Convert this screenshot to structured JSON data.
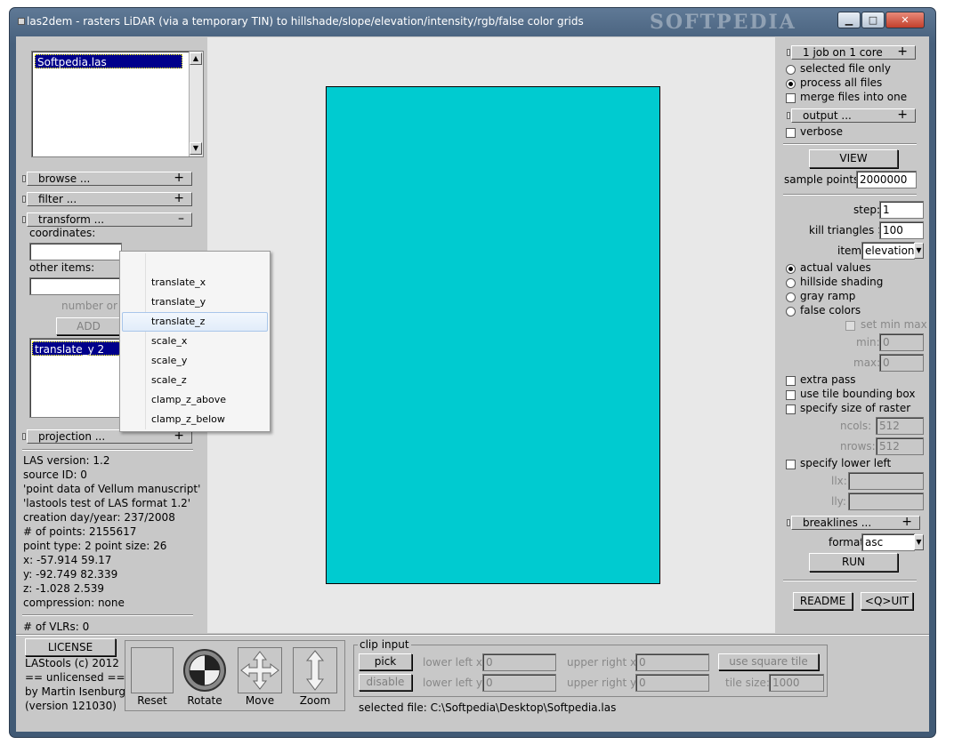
{
  "window": {
    "title": "las2dem - rasters LiDAR (via a temporary TIN) to hillshade/slope/elevation/intensity/rgb/false color grids",
    "watermark": "SOFTPEDIA",
    "minimize_glyph": "▁",
    "maximize_glyph": "□",
    "close_glyph": "✕"
  },
  "left_panel": {
    "file_list": [
      "Softpedia.las"
    ],
    "browse_label": "browse ...",
    "filter_label": "filter ...",
    "transform_label": "transform ...",
    "coordinates_label": "coordinates:",
    "other_items_label": "other items:",
    "number_or_value_hint": "number or v",
    "add_button": "ADD",
    "transform_list": [
      "translate_y 2"
    ],
    "projection_label": "projection ...",
    "info": [
      "LAS version: 1.2",
      "source ID: 0",
      "'point data of Vellum manuscript'",
      "'lastools test of LAS format 1.2'",
      "creation day/year: 237/2008",
      "# of points: 2155617",
      "point type: 2 point size: 26",
      "x: -57.914 59.17",
      "y: -92.749 82.339",
      "z: -1.028 2.539",
      "compression: none"
    ],
    "vlrs": "# of VLRs: 0",
    "plus": "+",
    "minus": "–"
  },
  "dropdown_menu": {
    "items": [
      "translate_x",
      "translate_y",
      "translate_z",
      "scale_x",
      "scale_y",
      "scale_z",
      "clamp_z_above",
      "clamp_z_below"
    ],
    "highlighted": "translate_z"
  },
  "right_panel": {
    "cores_label": "1 job on 1 core",
    "selected_file_only": "selected file only",
    "process_all_files": "process all files",
    "merge_files": "merge files into one",
    "output_label": "output ...",
    "verbose": "verbose",
    "view_button": "VIEW",
    "sample_points_label": "sample points:",
    "sample_points_value": "2000000",
    "step_label": "step:",
    "step_value": "1",
    "kill_label": "kill triangles >",
    "kill_value": "100",
    "item_label": "item:",
    "item_value": "elevation",
    "actual_values": "actual values",
    "hillside_shading": "hillside shading",
    "gray_ramp": "gray ramp",
    "false_colors": "false colors",
    "set_min_max": "set min max",
    "min_label": "min:",
    "min_value": "0",
    "max_label": "max:",
    "max_value": "0",
    "extra_pass": "extra pass",
    "use_tile_bb": "use tile bounding box",
    "specify_size": "specify size of raster",
    "ncols_label": "ncols:",
    "ncols_value": "512",
    "nrows_label": "nrows:",
    "nrows_value": "512",
    "specify_lower_left": "specify lower left",
    "llx_label": "llx:",
    "lly_label": "lly:",
    "breaklines_label": "breaklines ...",
    "format_label": "format:",
    "format_value": "asc",
    "run_button": "RUN",
    "readme_button": "README",
    "quit_button": "<Q>UIT"
  },
  "bottom": {
    "license_button": "LICENSE",
    "license_text": [
      "LAStools (c) 2012",
      "== unlicensed ==",
      "by Martin Isenburg",
      "(version 121030)"
    ],
    "reset": "Reset",
    "rotate": "Rotate",
    "move": "Move",
    "zoom": "Zoom",
    "clip_title": "clip input",
    "pick_button": "pick",
    "disable_button": "disable",
    "lower_left_x_label": "lower left x:",
    "lower_left_x_value": "0",
    "lower_left_y_label": "lower left y:",
    "lower_left_y_value": "0",
    "upper_right_x_label": "upper right x:",
    "upper_right_x_value": "0",
    "upper_right_y_label": "upper right y:",
    "upper_right_y_value": "0",
    "use_square_tile": "use square tile",
    "tile_size_label": "tile size:",
    "tile_size_value": "1000",
    "selected_file": "selected file: C:\\Softpedia\\Desktop\\Softpedia.las"
  },
  "colors": {
    "raster_fill": "#00cbd0",
    "selection": "#00008b"
  }
}
